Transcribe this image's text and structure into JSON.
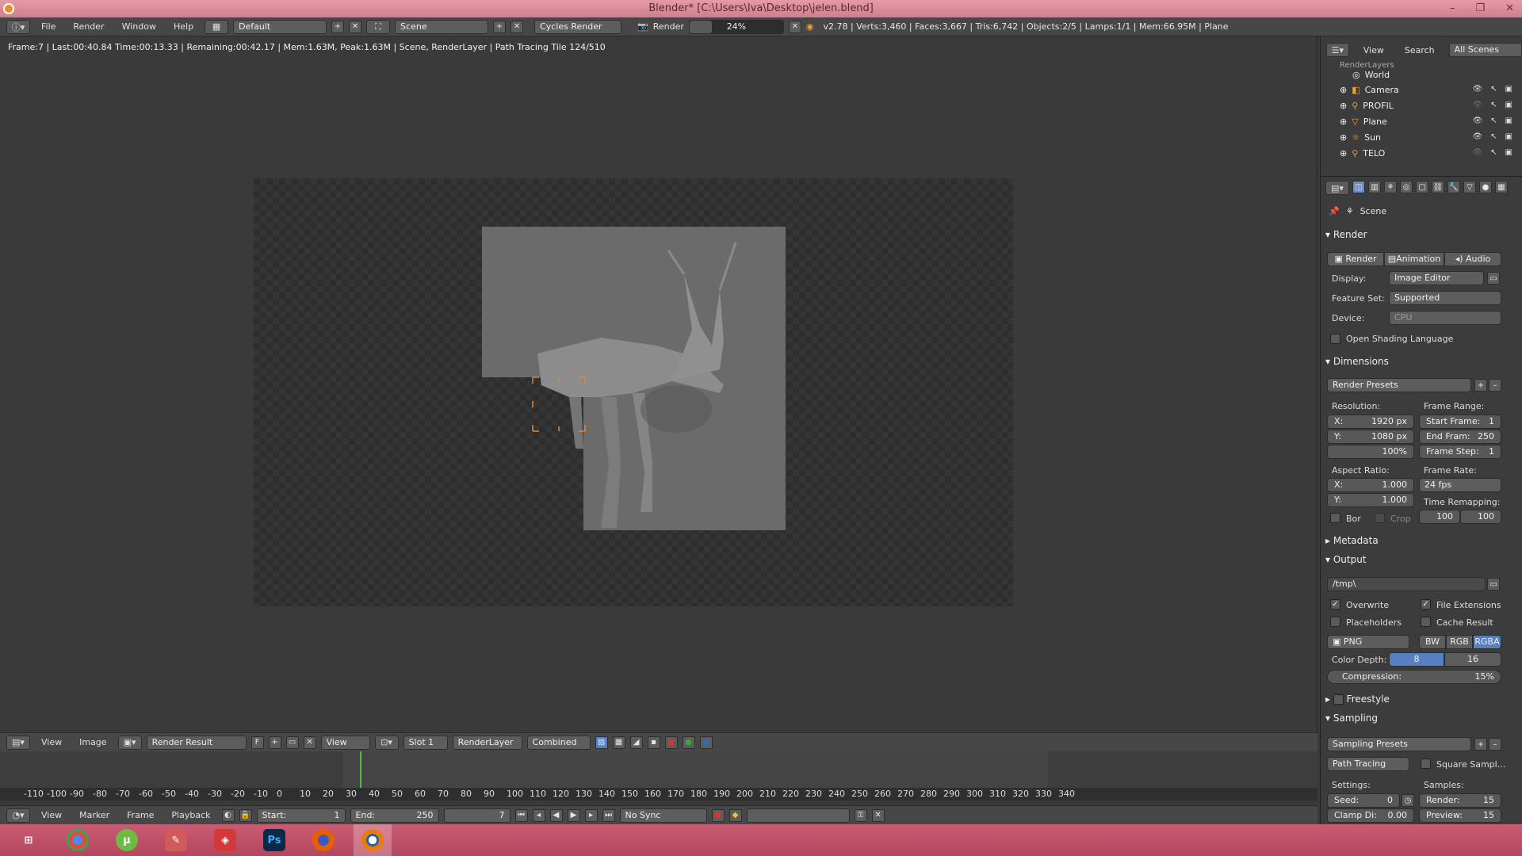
{
  "window": {
    "title": "Blender* [C:\\Users\\Iva\\Desktop\\jelen.blend]",
    "minimize": "–",
    "maximize": "❐",
    "close": "✕"
  },
  "topbar": {
    "menus": [
      "File",
      "Render",
      "Window",
      "Help"
    ],
    "screen_layout": "Default",
    "scene": "Scene",
    "engine": "Cycles Render",
    "render_label": "Render",
    "progress": "24%",
    "progress_fraction": 0.24,
    "stats": "v2.78 | Verts:3,460 | Faces:3,667 | Tris:6,742 | Objects:2/5 | Lamps:1/1 | Mem:66.95M | Plane"
  },
  "editor": {
    "status": "Frame:7 | Last:00:40.84 Time:00:13.33 | Remaining:00:42.17 | Mem:1.63M, Peak:1.63M | Scene, RenderLayer | Path Tracing Tile 124/510"
  },
  "image_header": {
    "menus": [
      "View",
      "Image"
    ],
    "image_name": "Render Result",
    "fake_user": "F",
    "view": "View",
    "slot": "Slot 1",
    "layer": "RenderLayer",
    "pass": "Combined"
  },
  "timeline": {
    "ticks": [
      "-110",
      "-100",
      "-90",
      "-80",
      "-70",
      "-60",
      "-50",
      "-40",
      "-30",
      "-20",
      "-10",
      "0",
      "10",
      "20",
      "30",
      "40",
      "50",
      "60",
      "70",
      "80",
      "90",
      "100",
      "110",
      "120",
      "130",
      "140",
      "150",
      "160",
      "170",
      "180",
      "190",
      "200",
      "210",
      "220",
      "230",
      "240",
      "250",
      "260",
      "270",
      "280",
      "290",
      "300",
      "310",
      "320",
      "330",
      "340"
    ],
    "menus": [
      "View",
      "Marker",
      "Frame",
      "Playback"
    ],
    "start": "Start:",
    "start_value": "1",
    "end": "End:",
    "end_value": "250",
    "current": "7",
    "sync": "No Sync"
  },
  "outliner": {
    "menus": [
      "View",
      "Search"
    ],
    "filter": "All Scenes",
    "top_partial": "RenderLayers",
    "items": [
      {
        "name": "World",
        "icon": "world-icon"
      },
      {
        "name": "Camera",
        "icon": "camera-icon"
      },
      {
        "name": "PROFIL",
        "icon": "armature-icon"
      },
      {
        "name": "Plane",
        "icon": "mesh-icon"
      },
      {
        "name": "Sun",
        "icon": "lamp-icon"
      },
      {
        "name": "TELO",
        "icon": "armature-icon"
      }
    ]
  },
  "properties": {
    "context": "Scene",
    "render_panel": "Render",
    "buttons": [
      "Render",
      "Animation",
      "Audio"
    ],
    "display_label": "Display:",
    "display_value": "Image Editor",
    "feature_label": "Feature Set:",
    "feature_value": "Supported",
    "device_label": "Device:",
    "device_value": "CPU",
    "osl": "Open Shading Language",
    "dimensions": "Dimensions",
    "render_presets": "Render Presets",
    "resolution": "Resolution:",
    "res_x": "X:",
    "res_x_val": "1920 px",
    "res_y": "Y:",
    "res_y_val": "1080 px",
    "res_pct": "100%",
    "frame_range": "Frame Range:",
    "start_frame": "Start Frame:",
    "start_frame_val": "1",
    "end_frame": "End Fram:",
    "end_frame_val": "250",
    "frame_step": "Frame Step:",
    "frame_step_val": "1",
    "aspect": "Aspect Ratio:",
    "asp_x": "X:",
    "asp_x_val": "1.000",
    "asp_y": "Y:",
    "asp_y_val": "1.000",
    "frame_rate": "Frame Rate:",
    "fps": "24 fps",
    "time_remap": "Time Remapping:",
    "remap_old": "100",
    "remap_new": "100",
    "border": "Bor",
    "crop": "Crop",
    "metadata": "Metadata",
    "output": "Output",
    "output_path": "/tmp\\",
    "overwrite": "Overwrite",
    "file_ext": "File Extensions",
    "placeholders": "Placeholders",
    "cache_result": "Cache Result",
    "format": "PNG",
    "bw": "BW",
    "rgb": "RGB",
    "rgba": "RGBA",
    "color_depth": "Color Depth:",
    "depth_8": "8",
    "depth_16": "16",
    "compression": "Compression:",
    "compression_val": "15%",
    "freestyle": "Freestyle",
    "sampling": "Sampling",
    "sampling_presets": "Sampling Presets",
    "integrator": "Path Tracing",
    "square_samples": "Square Sampl...",
    "settings": "Settings:",
    "samples": "Samples:",
    "seed": "Seed:",
    "seed_val": "0",
    "clamp": "Clamp Di:",
    "clamp_val": "0.00",
    "render_samples": "Render:",
    "render_samples_val": "15",
    "preview_samples": "Preview:",
    "preview_samples_val": "15"
  },
  "taskbar": {
    "apps": [
      {
        "name": "windows-start-icon",
        "color": "#ffffff"
      },
      {
        "name": "chrome-icon",
        "color": "#4caf50"
      },
      {
        "name": "utorrent-icon",
        "color": "#6dbb43"
      },
      {
        "name": "paint-icon",
        "color": "#d35a5a"
      },
      {
        "name": "sketchup-icon",
        "color": "#d23a3a"
      },
      {
        "name": "photoshop-icon",
        "color": "#0b2a4a",
        "label": "Ps"
      },
      {
        "name": "firefox-icon",
        "color": "#e66000"
      },
      {
        "name": "blender-icon",
        "color": "#e87d0d"
      }
    ]
  }
}
